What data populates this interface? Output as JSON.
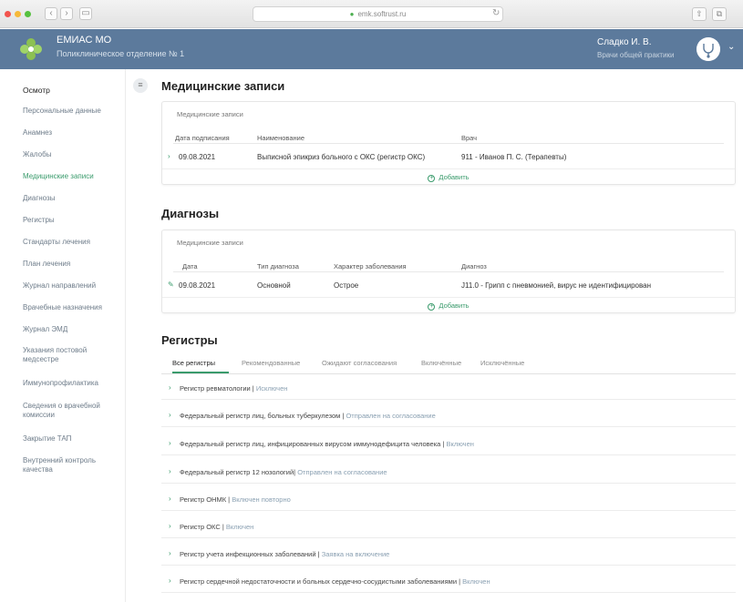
{
  "browser": {
    "url": "emk.softrust.ru",
    "nav_back": "‹",
    "nav_forward": "›",
    "sidebar_toggle": "▭",
    "reload": "↻",
    "share": "⇧",
    "tabs_btn": "⧉"
  },
  "header": {
    "brand": "ЕМИАС МО",
    "subtitle": "Поликлиническое отделение № 1",
    "user_name": "Сладко И. В.",
    "user_role": "Врачи общей практики",
    "user_chevron": "⌄"
  },
  "sidebar": {
    "items": [
      {
        "label": "Осмотр",
        "state": "header"
      },
      {
        "label": "Персональные данные",
        "state": "normal"
      },
      {
        "label": "Анамнез",
        "state": "normal"
      },
      {
        "label": "Жалобы",
        "state": "normal"
      },
      {
        "label": "Медицинские записи",
        "state": "active"
      },
      {
        "label": "Диагнозы",
        "state": "normal"
      },
      {
        "label": "Регистры",
        "state": "normal"
      },
      {
        "label": "Стандарты лечения",
        "state": "normal"
      },
      {
        "label": "План лечения",
        "state": "normal"
      },
      {
        "label": "Журнал направлений",
        "state": "normal"
      },
      {
        "label": "Врачебные назначения",
        "state": "normal"
      },
      {
        "label": "Журнал ЭМД",
        "state": "normal"
      },
      {
        "label": "Указания постовой медсестре",
        "state": "normal"
      },
      {
        "label": "Иммунопрофилактика",
        "state": "normal"
      },
      {
        "label": "Сведения о врачебной комиссии",
        "state": "normal"
      },
      {
        "label": "Закрытие ТАП",
        "state": "normal"
      },
      {
        "label": "Внутренний контроль качества",
        "state": "normal"
      }
    ]
  },
  "main": {
    "menu_toggle": "≡",
    "medical_records": {
      "title": "Медицинские записи",
      "card_title": "Медицинские записи",
      "columns": [
        "Дата подписания",
        "Наименование",
        "Врач"
      ],
      "rows": [
        {
          "icon": "›",
          "date": "09.08.2021",
          "name": "Выписной эпикриз больного с ОКС (регистр ОКС)",
          "doctor": "911 - Иванов П. С. (Терапевты)"
        }
      ],
      "add_label": "Добавить"
    },
    "diagnoses": {
      "title": "Диагнозы",
      "card_title": "Медицинские записи",
      "columns": [
        "Дата",
        "Тип диагноза",
        "Характер заболевания",
        "Диагноз"
      ],
      "rows": [
        {
          "icon": "✎",
          "date": "09.08.2021",
          "type": "Основной",
          "character": "Острое",
          "diagnosis": "J11.0 - Грипп с пневмонией, вирус не идентифицирован"
        }
      ],
      "add_label": "Добавить"
    },
    "registers": {
      "title": "Регистры",
      "tabs": [
        "Все регистры",
        "Рекомендованные",
        "Ожидают согласования",
        "Включённые",
        "Исключённые"
      ],
      "active_tab": 0,
      "rows": [
        {
          "name": "Регистр ревматологии",
          "status": "Исключен"
        },
        {
          "name": "Федеральный регистр лиц, больных туберкулезом",
          "status": "Отправлен на согласование"
        },
        {
          "name": "Федеральный регистр лиц, инфицированных вирусом иммунодефицита человека",
          "status": "Включен"
        },
        {
          "name": "Федеральный регистр 12 нозологий",
          "status": "Отправлен на согласование"
        },
        {
          "name": "Регистр ОНМК",
          "status": "Включен повторно"
        },
        {
          "name": "Регистр ОКС",
          "status": "Включен"
        },
        {
          "name": "Регистр учета инфекционных заболеваний",
          "status": "Заявка на включение"
        },
        {
          "name": "Регистр сердечной недостаточности и больных сердечно-сосудистыми заболеваниями",
          "status": "Включен"
        }
      ]
    }
  },
  "colors": {
    "accent": "#3a9b6c",
    "header_bg": "#5c7a9c",
    "status_text": "#8aa0b2"
  }
}
